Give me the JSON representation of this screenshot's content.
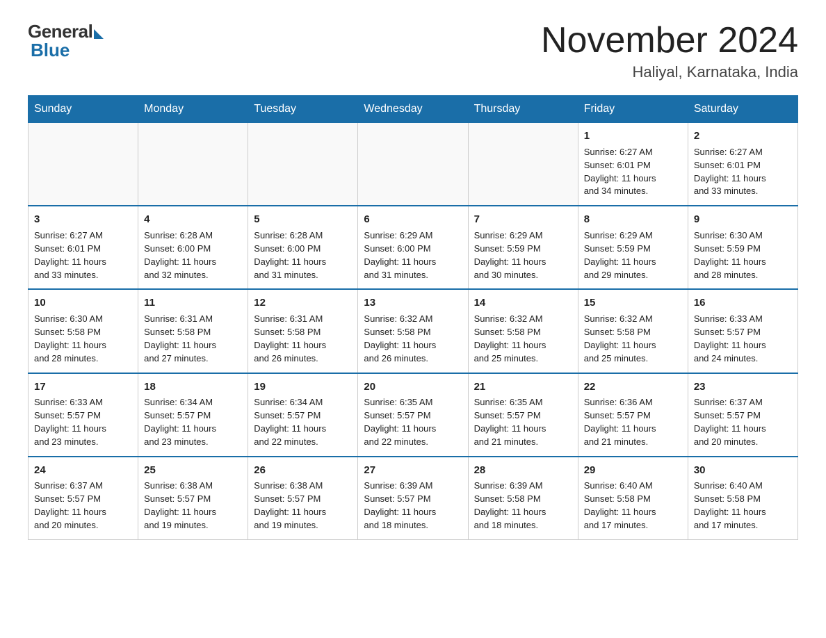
{
  "header": {
    "logo_general": "General",
    "logo_blue": "Blue",
    "month": "November 2024",
    "location": "Haliyal, Karnataka, India"
  },
  "weekdays": [
    "Sunday",
    "Monday",
    "Tuesday",
    "Wednesday",
    "Thursday",
    "Friday",
    "Saturday"
  ],
  "weeks": [
    [
      {
        "day": "",
        "info": ""
      },
      {
        "day": "",
        "info": ""
      },
      {
        "day": "",
        "info": ""
      },
      {
        "day": "",
        "info": ""
      },
      {
        "day": "",
        "info": ""
      },
      {
        "day": "1",
        "info": "Sunrise: 6:27 AM\nSunset: 6:01 PM\nDaylight: 11 hours\nand 34 minutes."
      },
      {
        "day": "2",
        "info": "Sunrise: 6:27 AM\nSunset: 6:01 PM\nDaylight: 11 hours\nand 33 minutes."
      }
    ],
    [
      {
        "day": "3",
        "info": "Sunrise: 6:27 AM\nSunset: 6:01 PM\nDaylight: 11 hours\nand 33 minutes."
      },
      {
        "day": "4",
        "info": "Sunrise: 6:28 AM\nSunset: 6:00 PM\nDaylight: 11 hours\nand 32 minutes."
      },
      {
        "day": "5",
        "info": "Sunrise: 6:28 AM\nSunset: 6:00 PM\nDaylight: 11 hours\nand 31 minutes."
      },
      {
        "day": "6",
        "info": "Sunrise: 6:29 AM\nSunset: 6:00 PM\nDaylight: 11 hours\nand 31 minutes."
      },
      {
        "day": "7",
        "info": "Sunrise: 6:29 AM\nSunset: 5:59 PM\nDaylight: 11 hours\nand 30 minutes."
      },
      {
        "day": "8",
        "info": "Sunrise: 6:29 AM\nSunset: 5:59 PM\nDaylight: 11 hours\nand 29 minutes."
      },
      {
        "day": "9",
        "info": "Sunrise: 6:30 AM\nSunset: 5:59 PM\nDaylight: 11 hours\nand 28 minutes."
      }
    ],
    [
      {
        "day": "10",
        "info": "Sunrise: 6:30 AM\nSunset: 5:58 PM\nDaylight: 11 hours\nand 28 minutes."
      },
      {
        "day": "11",
        "info": "Sunrise: 6:31 AM\nSunset: 5:58 PM\nDaylight: 11 hours\nand 27 minutes."
      },
      {
        "day": "12",
        "info": "Sunrise: 6:31 AM\nSunset: 5:58 PM\nDaylight: 11 hours\nand 26 minutes."
      },
      {
        "day": "13",
        "info": "Sunrise: 6:32 AM\nSunset: 5:58 PM\nDaylight: 11 hours\nand 26 minutes."
      },
      {
        "day": "14",
        "info": "Sunrise: 6:32 AM\nSunset: 5:58 PM\nDaylight: 11 hours\nand 25 minutes."
      },
      {
        "day": "15",
        "info": "Sunrise: 6:32 AM\nSunset: 5:58 PM\nDaylight: 11 hours\nand 25 minutes."
      },
      {
        "day": "16",
        "info": "Sunrise: 6:33 AM\nSunset: 5:57 PM\nDaylight: 11 hours\nand 24 minutes."
      }
    ],
    [
      {
        "day": "17",
        "info": "Sunrise: 6:33 AM\nSunset: 5:57 PM\nDaylight: 11 hours\nand 23 minutes."
      },
      {
        "day": "18",
        "info": "Sunrise: 6:34 AM\nSunset: 5:57 PM\nDaylight: 11 hours\nand 23 minutes."
      },
      {
        "day": "19",
        "info": "Sunrise: 6:34 AM\nSunset: 5:57 PM\nDaylight: 11 hours\nand 22 minutes."
      },
      {
        "day": "20",
        "info": "Sunrise: 6:35 AM\nSunset: 5:57 PM\nDaylight: 11 hours\nand 22 minutes."
      },
      {
        "day": "21",
        "info": "Sunrise: 6:35 AM\nSunset: 5:57 PM\nDaylight: 11 hours\nand 21 minutes."
      },
      {
        "day": "22",
        "info": "Sunrise: 6:36 AM\nSunset: 5:57 PM\nDaylight: 11 hours\nand 21 minutes."
      },
      {
        "day": "23",
        "info": "Sunrise: 6:37 AM\nSunset: 5:57 PM\nDaylight: 11 hours\nand 20 minutes."
      }
    ],
    [
      {
        "day": "24",
        "info": "Sunrise: 6:37 AM\nSunset: 5:57 PM\nDaylight: 11 hours\nand 20 minutes."
      },
      {
        "day": "25",
        "info": "Sunrise: 6:38 AM\nSunset: 5:57 PM\nDaylight: 11 hours\nand 19 minutes."
      },
      {
        "day": "26",
        "info": "Sunrise: 6:38 AM\nSunset: 5:57 PM\nDaylight: 11 hours\nand 19 minutes."
      },
      {
        "day": "27",
        "info": "Sunrise: 6:39 AM\nSunset: 5:57 PM\nDaylight: 11 hours\nand 18 minutes."
      },
      {
        "day": "28",
        "info": "Sunrise: 6:39 AM\nSunset: 5:58 PM\nDaylight: 11 hours\nand 18 minutes."
      },
      {
        "day": "29",
        "info": "Sunrise: 6:40 AM\nSunset: 5:58 PM\nDaylight: 11 hours\nand 17 minutes."
      },
      {
        "day": "30",
        "info": "Sunrise: 6:40 AM\nSunset: 5:58 PM\nDaylight: 11 hours\nand 17 minutes."
      }
    ]
  ]
}
